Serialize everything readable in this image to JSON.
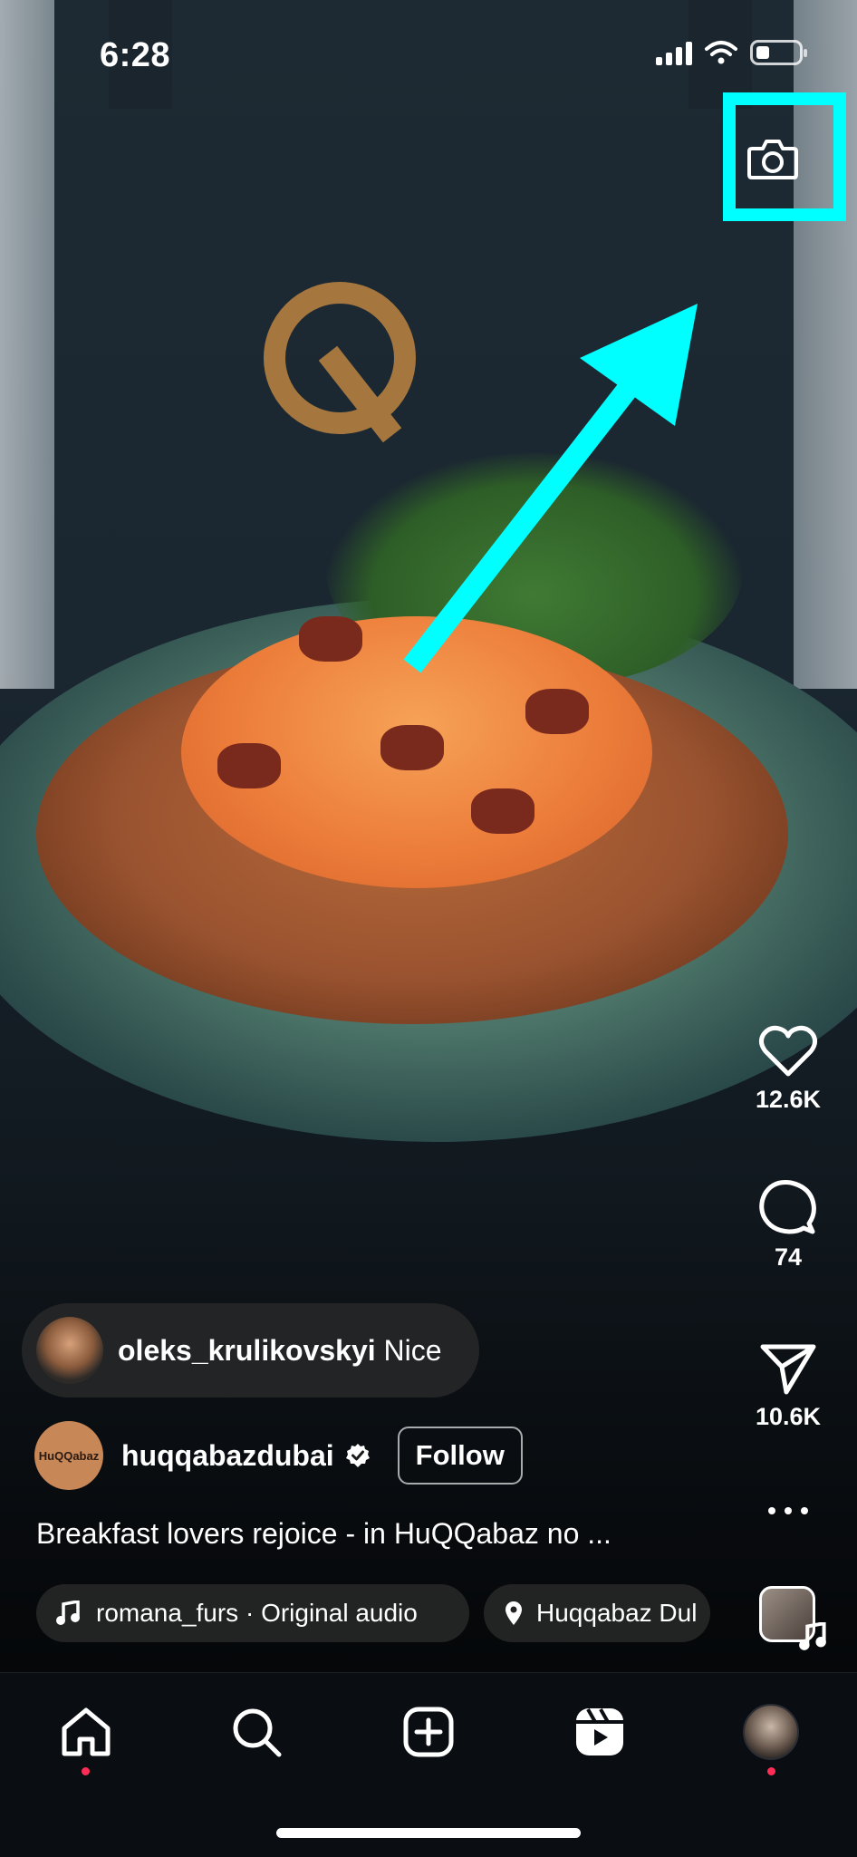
{
  "status_bar": {
    "time": "6:28"
  },
  "header": {
    "camera_icon": "camera-icon"
  },
  "annotation": {
    "color": "#00ffff"
  },
  "actions": {
    "likes": "12.6K",
    "comments": "74",
    "shares": "10.6K"
  },
  "comment_preview": {
    "username": "oleks_krulikovskyi",
    "text": "Nice"
  },
  "author": {
    "avatar_text": "HuQQabaz",
    "username": "huqqabazdubai",
    "follow_label": "Follow"
  },
  "caption": "Breakfast lovers rejoice - in HuQQabaz no ...",
  "audio": {
    "label": "romana_furs · Original audio"
  },
  "location": {
    "label": "Huqqabaz Dul"
  },
  "tabbar": {
    "items": [
      "home-icon",
      "search-icon",
      "create-icon",
      "reels-icon",
      "profile-avatar"
    ]
  },
  "colors": {
    "notification_dot": "#ff2d55",
    "highlight": "#00ffff"
  }
}
